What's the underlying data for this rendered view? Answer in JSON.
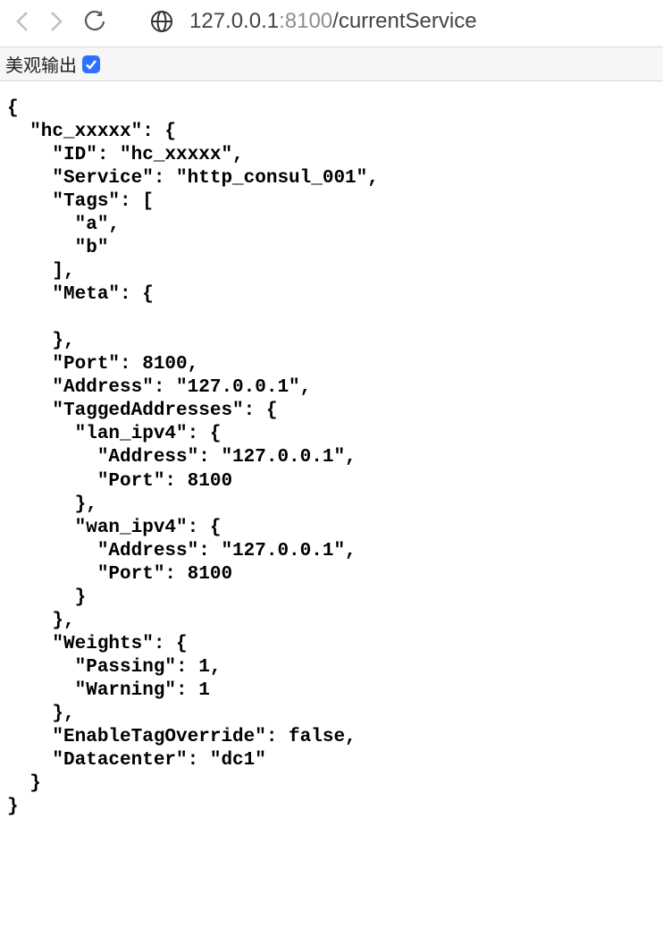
{
  "url": {
    "host": "127.0.0.1",
    "port": ":8100",
    "path": "/currentService"
  },
  "pretty": {
    "label": "美观输出"
  },
  "json": {
    "hc_xxxxx": {
      "ID": "hc_xxxxx",
      "Service": "http_consul_001",
      "Tags": [
        "a",
        "b"
      ],
      "Meta": {},
      "Port": 8100,
      "Address": "127.0.0.1",
      "TaggedAddresses": {
        "lan_ipv4": {
          "Address": "127.0.0.1",
          "Port": 8100
        },
        "wan_ipv4": {
          "Address": "127.0.0.1",
          "Port": 8100
        }
      },
      "Weights": {
        "Passing": 1,
        "Warning": 1
      },
      "EnableTagOverride": false,
      "Datacenter": "dc1"
    }
  }
}
